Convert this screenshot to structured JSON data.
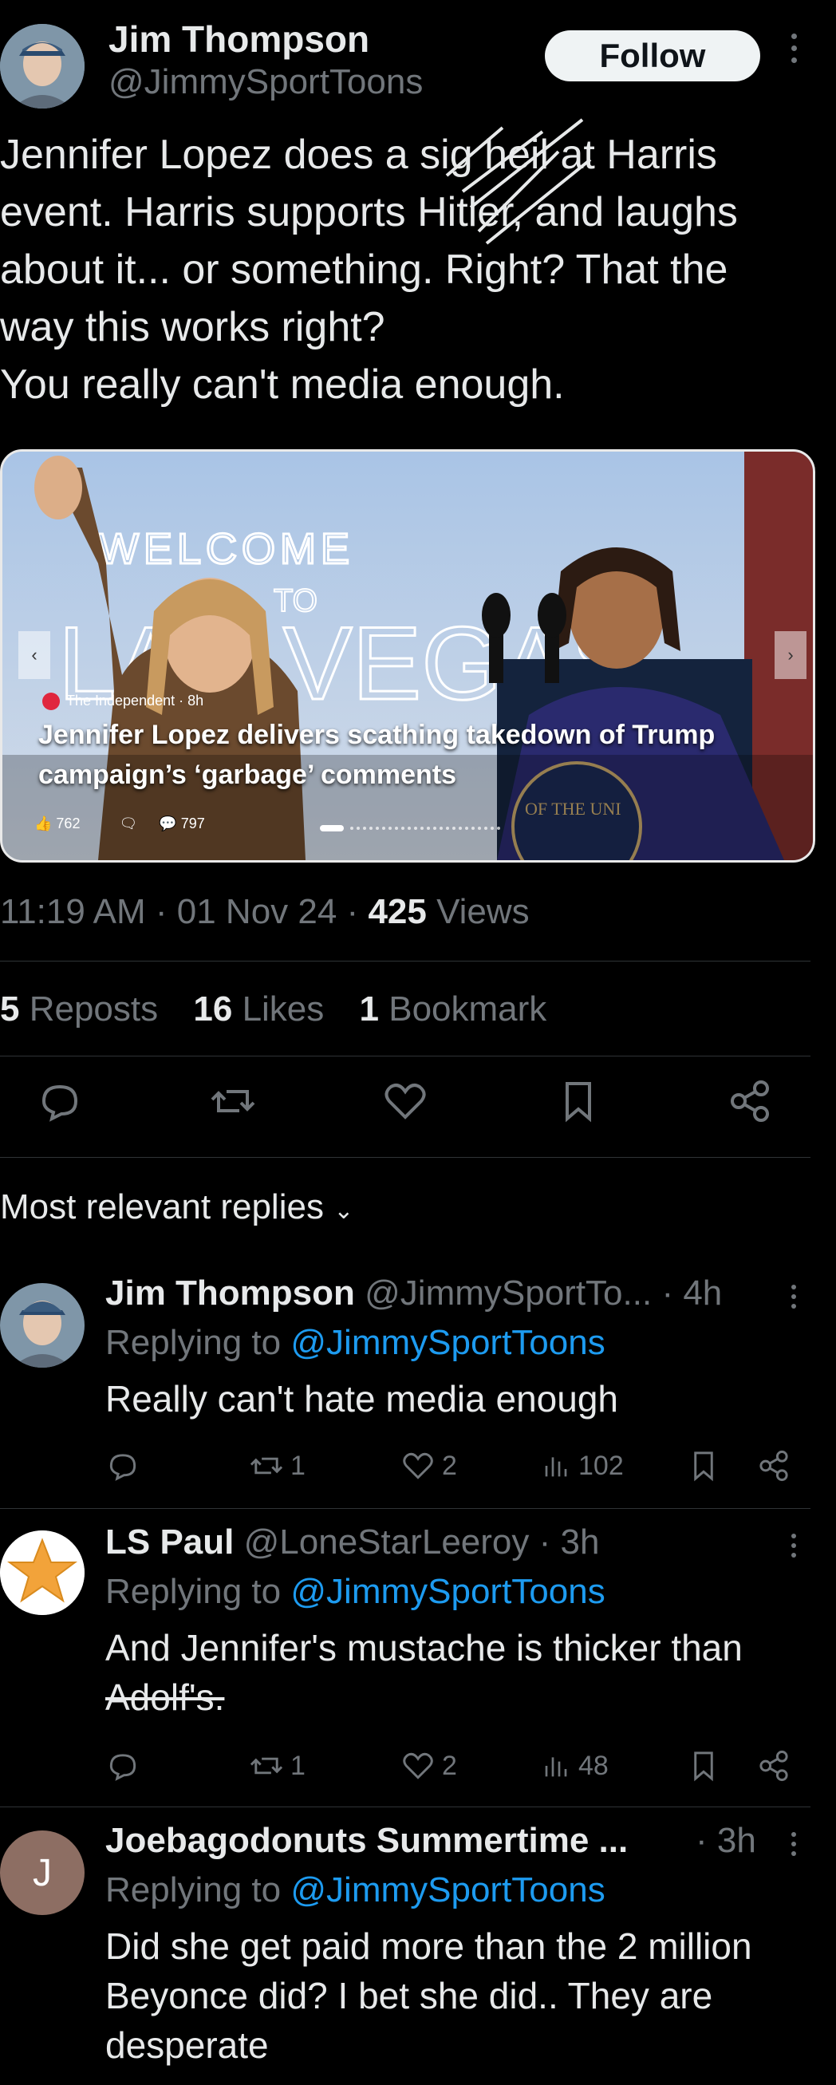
{
  "tweet": {
    "author_name": "Jim Thompson",
    "author_handle": "@JimmySportToons",
    "follow_label": "Follow",
    "text_lines": [
      "Jennifer Lopez does a sig heil at Harris",
      "event. Harris supports Hitler, and laughs",
      "about it... or something. Right? That the",
      "way this works right?",
      "You really can't media enough."
    ]
  },
  "card": {
    "source": "The Independent · 8h",
    "title_line1": "Jennifer Lopez delivers scathing takedown of Trump",
    "title_line2": "campaign’s ‘garbage’ comments",
    "likes": "762",
    "comments": "797",
    "sign_text": "WELCOME",
    "sign_to": "TO",
    "sign_vegas": "LAS VEGAS",
    "seal_text": "OF THE UNI"
  },
  "meta": {
    "time": "11:19 AM",
    "date": "01 Nov 24",
    "views_count": "425",
    "views_label": "Views",
    "reposts_count": "5",
    "reposts_label": "Reposts",
    "likes_count": "16",
    "likes_label": "Likes",
    "bookmarks_count": "1",
    "bookmarks_label": "Bookmark"
  },
  "actions": [
    "reply-icon",
    "repost-icon",
    "like-icon",
    "bookmark-icon",
    "share-icon"
  ],
  "replies_sort_label": "Most relevant replies",
  "replies": [
    {
      "name": "Jim Thompson",
      "handle": "@JimmySportTo...",
      "time": "· 4h",
      "replying_label": "Replying to",
      "replying_to": "@JimmySportToons",
      "body": "Really can't hate media enough",
      "reposts": "1",
      "likes": "2",
      "views": "102"
    },
    {
      "name": "LS Paul",
      "handle": "@LoneStarLeeroy",
      "time": "· 3h",
      "replying_label": "Replying to",
      "replying_to": "@JimmySportToons",
      "body_line1": "And Jennifer's mustache is thicker than",
      "body_line2": "Adolf's.",
      "reposts": "1",
      "likes": "2",
      "views": "48"
    },
    {
      "name": "Joebagodonuts Summertime ...",
      "avatar_letter": "J",
      "time": "· 3h",
      "replying_label": "Replying to",
      "replying_to": "@JimmySportToons",
      "body_line1": "Did she get paid more than the 2 million",
      "body_line2": "Beyonce did? I bet she did.. They are",
      "body_line3": "desperate"
    }
  ],
  "colors": {
    "background": "#000000",
    "text": "#e7e9ea",
    "muted": "#71767b",
    "link": "#1d9bf0",
    "divider": "#2f3336"
  }
}
